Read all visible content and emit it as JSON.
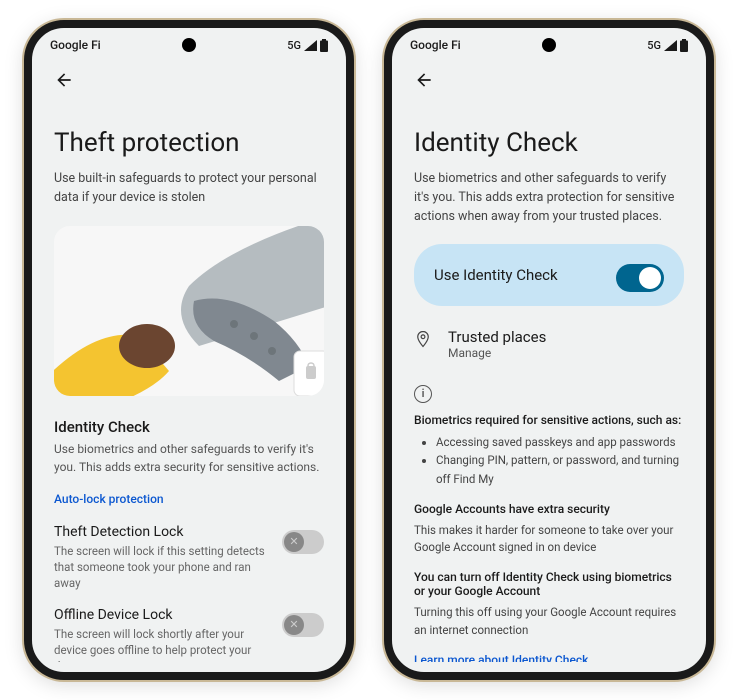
{
  "status": {
    "carrier": "Google Fi",
    "network": "5G"
  },
  "screen1": {
    "title": "Theft protection",
    "subtitle": "Use built-in safeguards to protect your personal data if your device is stolen",
    "identity": {
      "title": "Identity Check",
      "desc": "Use biometrics and other safeguards to verify it's you. This adds extra security for sensitive actions."
    },
    "autolock_link": "Auto-lock protection",
    "theft_lock": {
      "title": "Theft Detection Lock",
      "desc": "The screen will lock if this setting detects that someone took your phone and ran away"
    },
    "offline_lock": {
      "title": "Offline Device Lock",
      "desc": "The screen will lock shortly after your device goes offline to help protect your data"
    }
  },
  "screen2": {
    "title": "Identity Check",
    "subtitle": "Use biometrics and other safeguards to verify it's you. This adds extra protection for sensitive actions when away from your trusted places.",
    "toggle_label": "Use Identity Check",
    "toggle_state": true,
    "trusted": {
      "title": "Trusted places",
      "sub": "Manage"
    },
    "info": {
      "heading1": "Biometrics required for sensitive actions, such as:",
      "bullets": [
        "Accessing saved passkeys and app passwords",
        "Changing PIN, pattern, or password, and turning off Find My"
      ],
      "heading2": "Google Accounts have extra security",
      "para2": "This makes it harder for someone to take over your Google Account signed in on device",
      "heading3": "You can turn off Identity Check using biometrics or your Google Account",
      "para3": "Turning this off using your Google Account requires an internet connection",
      "learn_link": "Learn more about Identity Check"
    }
  }
}
